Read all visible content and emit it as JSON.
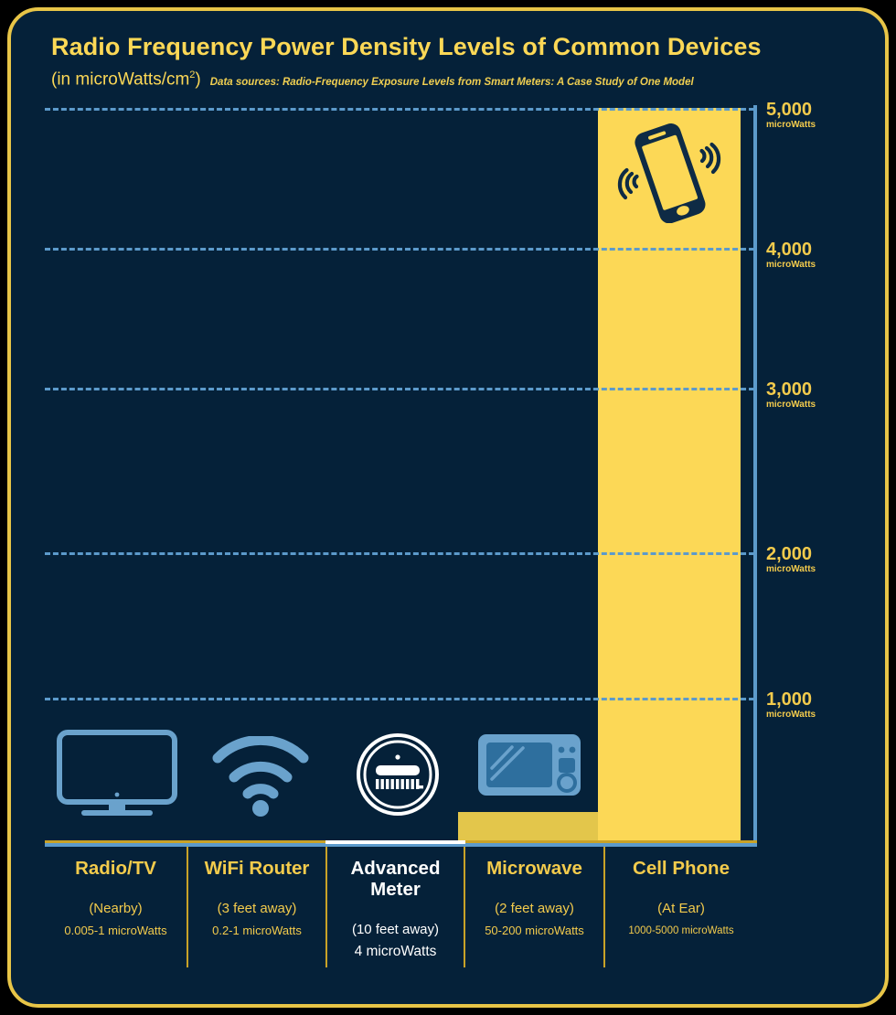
{
  "header": {
    "title": "Radio Frequency Power Density Levels of Common Devices",
    "units": "(in microWatts/cm",
    "units_sup": "2",
    "units_close": ")",
    "sources": "Data sources: Radio-Frequency Exposure Levels from Smart Meters: A Case Study of One Model"
  },
  "colors": {
    "background": "#052139",
    "frame": "#E8C547",
    "accent_yellow": "#FCD856",
    "label_gold": "#F3CB4C",
    "bar_cell": "#FCD856",
    "bar_microwave": "#E3C64B",
    "grid_blue": "#5C9ACB",
    "axis_blue": "#5C9ACB",
    "highlight_white": "#FFFFFF",
    "divider_gold": "#C9A227"
  },
  "chart_data": {
    "type": "bar",
    "title": "Radio Frequency Power Density Levels of Common Devices",
    "subtitle": "(in microWatts/cm2)",
    "ylabel": "microWatts",
    "xlabel": "",
    "ylim": [
      0,
      5000
    ],
    "grid": true,
    "legend": "none",
    "yticks": [
      1000,
      2000,
      3000,
      4000,
      5000
    ],
    "ytick_labels": [
      "1,000",
      "2,000",
      "3,000",
      "4,000",
      "5,000"
    ],
    "ytick_unit": "microWatts",
    "categories": [
      "Radio/TV",
      "WiFi Router",
      "Advanced Meter",
      "Microwave",
      "Cell Phone"
    ],
    "values_low": [
      0.005,
      0.2,
      4,
      50,
      1000
    ],
    "values_high": [
      1,
      1,
      4,
      200,
      5000
    ],
    "values": [
      1,
      1,
      4,
      200,
      5000
    ],
    "annotations": [
      "Radio/TV (Nearby): 0.005-1 microWatts",
      "WiFi Router (3 feet away): 0.2-1 microWatts",
      "Advanced Meter (10 feet away): 4 microWatts",
      "Microwave (2 feet away): 50-200 microWatts",
      "Cell Phone (At Ear): 1000-5000 microWatts"
    ]
  },
  "yaxis": {
    "ticks": [
      {
        "value": "5,000",
        "unit": "microWatts"
      },
      {
        "value": "4,000",
        "unit": "microWatts"
      },
      {
        "value": "3,000",
        "unit": "microWatts"
      },
      {
        "value": "2,000",
        "unit": "microWatts"
      },
      {
        "value": "1,000",
        "unit": "microWatts"
      }
    ]
  },
  "columns": [
    {
      "name": "Radio/TV",
      "distance": "(Nearby)",
      "value": "0.005-1 microWatts",
      "icon": "television-icon"
    },
    {
      "name": "WiFi Router",
      "distance": "(3 feet away)",
      "value": "0.2-1 microWatts",
      "icon": "wifi-icon"
    },
    {
      "name": "Advanced Meter",
      "distance": "(10 feet away)",
      "value": "4 microWatts",
      "icon": "smart-meter-icon"
    },
    {
      "name": "Microwave",
      "distance": "(2 feet away)",
      "value": "50-200 microWatts",
      "icon": "microwave-icon"
    },
    {
      "name": "Cell Phone",
      "distance": "(At Ear)",
      "value": "1000-5000 microWatts",
      "icon": "cell-phone-icon"
    }
  ]
}
